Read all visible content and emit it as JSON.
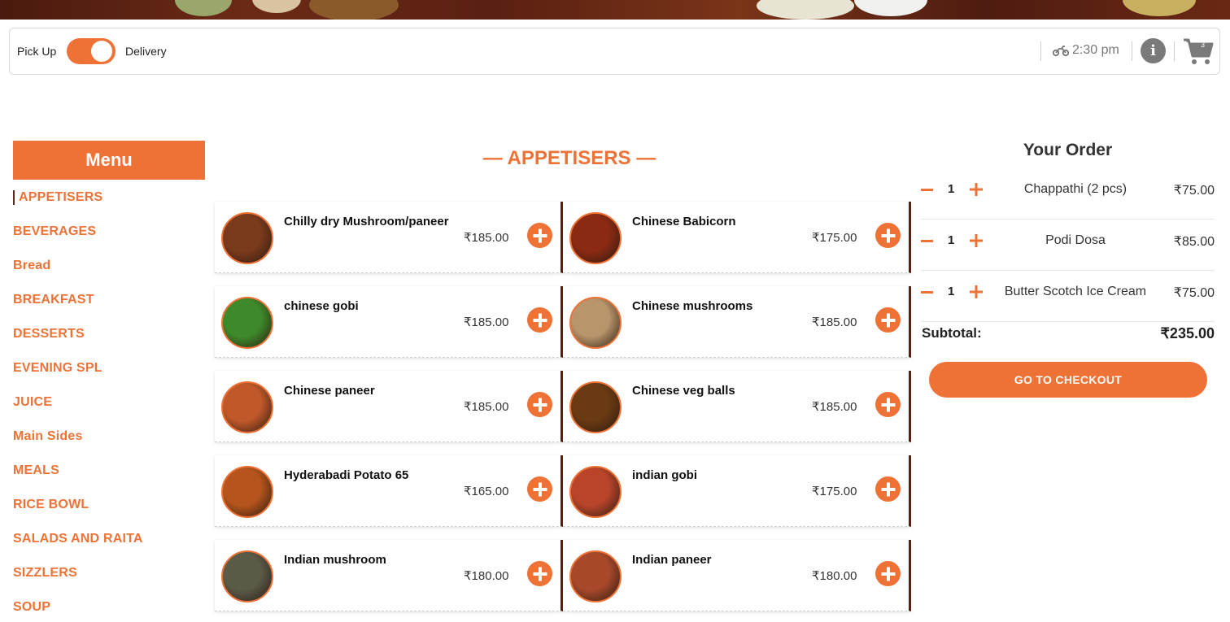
{
  "topbar": {
    "pickup_label": "Pick Up",
    "delivery_label": "Delivery",
    "delivery_time": "2:30 pm",
    "cart_count": "3"
  },
  "menu": {
    "title": "Menu",
    "categories": [
      "APPETISERS",
      "BEVERAGES",
      "Bread",
      "BREAKFAST",
      "DESSERTS",
      "EVENING SPL",
      "JUICE",
      "Main Sides",
      "MEALS",
      "RICE BOWL",
      "SALADS AND RAITA",
      "SIZZLERS",
      "SOUP"
    ]
  },
  "section": {
    "title": "— APPETISERS —"
  },
  "items": [
    {
      "name": "Chilly dry Mushroom/paneer",
      "price": "₹185.00",
      "color": "#7a3a1c"
    },
    {
      "name": "Chinese Babicorn",
      "price": "₹175.00",
      "color": "#8a2a12"
    },
    {
      "name": "chinese gobi",
      "price": "₹185.00",
      "color": "#3e8a2a"
    },
    {
      "name": "Chinese mushrooms",
      "price": "₹185.00",
      "color": "#b8956a"
    },
    {
      "name": "Chinese paneer",
      "price": "₹185.00",
      "color": "#c0582a"
    },
    {
      "name": "Chinese veg balls",
      "price": "₹185.00",
      "color": "#6a3a12"
    },
    {
      "name": "Hyderabadi Potato 65",
      "price": "₹165.00",
      "color": "#b5541c"
    },
    {
      "name": "indian gobi",
      "price": "₹175.00",
      "color": "#b8442a"
    },
    {
      "name": "Indian mushroom",
      "price": "₹180.00",
      "color": "#5a5a48"
    },
    {
      "name": "Indian paneer",
      "price": "₹180.00",
      "color": "#a8482a"
    }
  ],
  "order": {
    "title": "Your Order",
    "lines": [
      {
        "qty": "1",
        "name": "Chappathi (2 pcs)",
        "price": "₹75.00"
      },
      {
        "qty": "1",
        "name": "Podi Dosa",
        "price": "₹85.00"
      },
      {
        "qty": "1",
        "name": "Butter Scotch Ice Cream",
        "price": "₹75.00"
      }
    ],
    "subtotal_label": "Subtotal:",
    "subtotal_value": "₹235.00",
    "checkout_label": "GO TO CHECKOUT"
  },
  "colors": {
    "accent": "#ee7236",
    "dark_brown": "#5a1f10"
  }
}
